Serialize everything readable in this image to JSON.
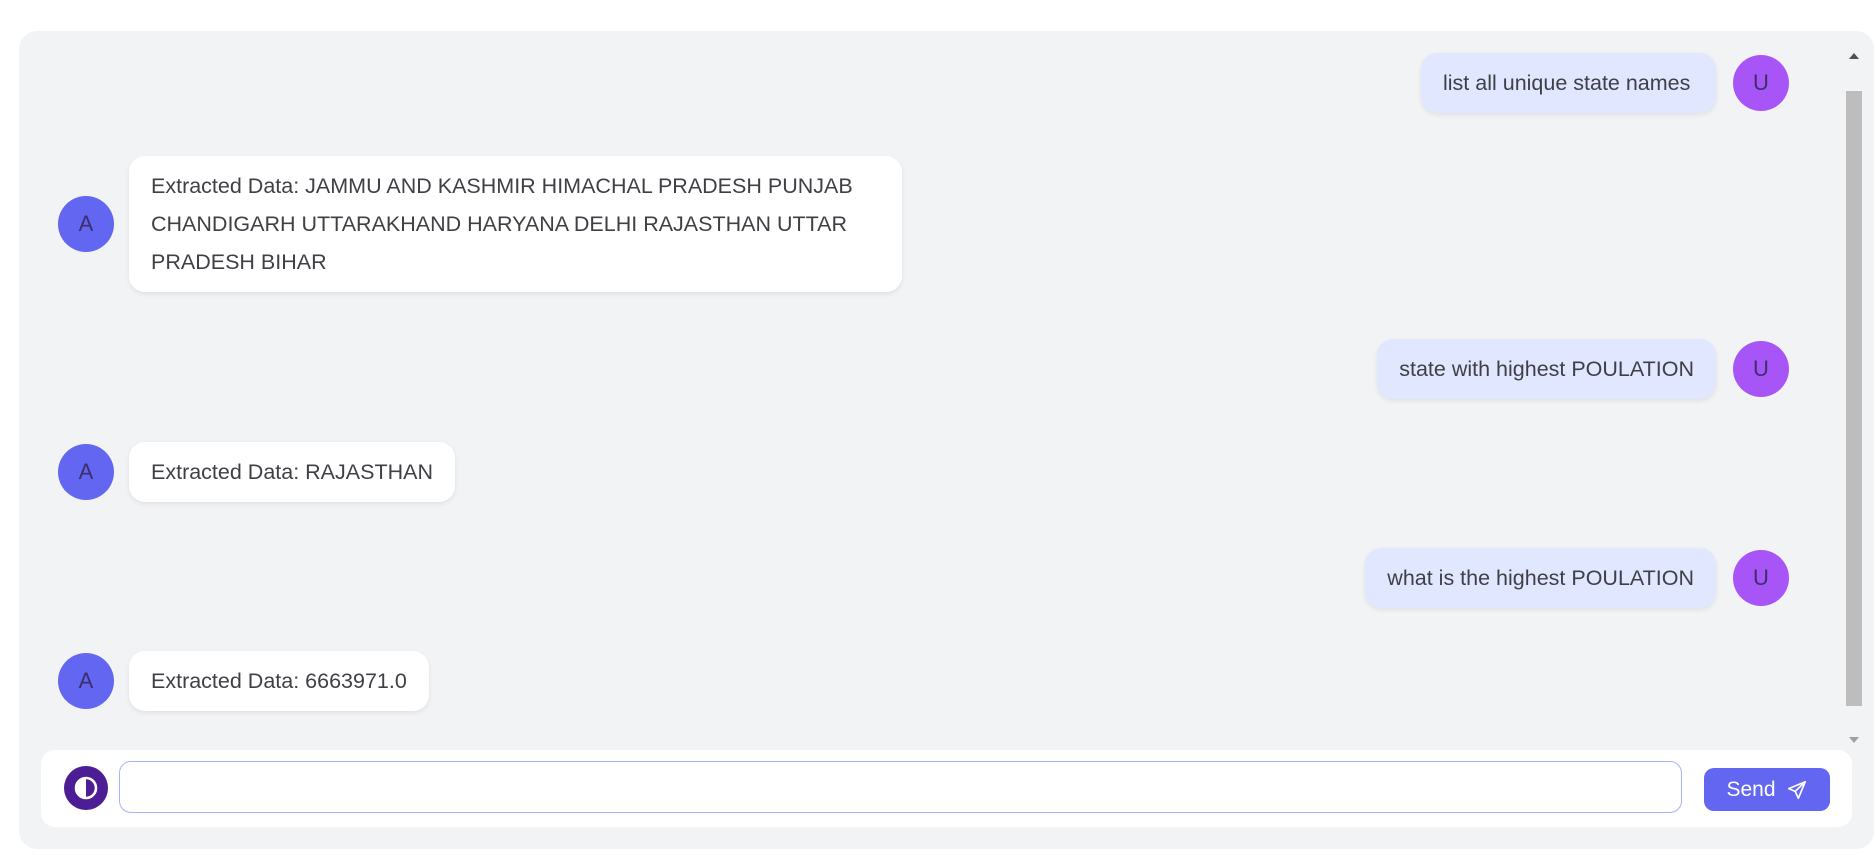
{
  "messages": [
    {
      "role": "user",
      "text": "list all unique state names",
      "avatar": "U"
    },
    {
      "role": "assistant",
      "text": "Extracted Data: JAMMU AND KASHMIR HIMACHAL PRADESH PUNJAB CHANDIGARH UTTARAKHAND HARYANA DELHI RAJASTHAN UTTAR PRADESH BIHAR",
      "avatar": "A"
    },
    {
      "role": "user",
      "text": "state with highest POULATION",
      "avatar": "U"
    },
    {
      "role": "assistant",
      "text": "Extracted Data: RAJASTHAN",
      "avatar": "A"
    },
    {
      "role": "user",
      "text": "what is the highest POULATION",
      "avatar": "U"
    },
    {
      "role": "assistant",
      "text": "Extracted Data: 6663971.0",
      "avatar": "A"
    }
  ],
  "input": {
    "value": "",
    "placeholder": ""
  },
  "send_label": "Send",
  "colors": {
    "panel_bg": "#f2f3f5",
    "user_avatar": "#a855f7",
    "assistant_avatar": "#6366f1",
    "user_bubble": "#e0e7ff",
    "send_button": "#6366f1",
    "theme_toggle": "#4c1d95"
  },
  "icons": {
    "theme": "contrast-icon",
    "send": "paper-plane-icon"
  }
}
